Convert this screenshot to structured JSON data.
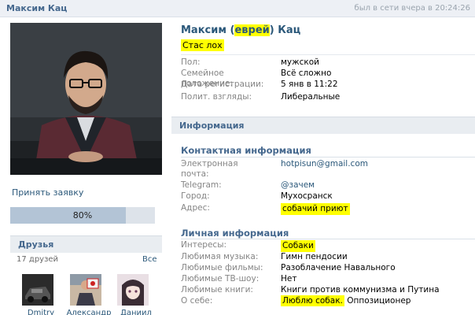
{
  "header": {
    "name": "Максим Кац",
    "online": "был в сети вчера в 20:24:26"
  },
  "left": {
    "accept_request": "Принять заявку",
    "progress_label": "80%",
    "progress_value": 0.8,
    "friends_title": "Друзья",
    "friends_count": "17 друзей",
    "friends_all": "Все",
    "friends": [
      {
        "name": "Dmitry",
        "icon": "friend-photo-dark-car"
      },
      {
        "name": "Александр",
        "icon": "friend-photo-man-with-sign"
      },
      {
        "name": "Даниил",
        "icon": "friend-photo-anime-girl"
      }
    ]
  },
  "profile": {
    "name_first": "Максим",
    "name_paren_open": "(",
    "name_nick": "еврей",
    "name_paren_close": ")",
    "name_last": "Кац",
    "status": "Стас лох",
    "basic": [
      {
        "label": "Пол:",
        "value": "мужской"
      },
      {
        "label": "Семейное положение:",
        "value": "Всё сложно"
      },
      {
        "label": "Дата регистрации:",
        "value": "5 янв в 11:22"
      },
      {
        "label": "Полит. взгляды:",
        "value": "Либеральные"
      }
    ]
  },
  "info": {
    "title": "Информация",
    "contact_title": "Контактная информация",
    "email_label_1": "Электронная",
    "email_label_2": "почта:",
    "email_value": "hotpisun@gmail.com",
    "telegram_label": "Telegram:",
    "telegram_value": "@зачем",
    "city_label": "Город:",
    "city_value": "Мухосранск",
    "address_label": "Адрес:",
    "address_value": "собачий приют",
    "personal_title": "Личная информация",
    "interests_label": "Интересы:",
    "interests_value": "Собаки",
    "music_label": "Любимая музыка:",
    "music_value": "Гимн пендосии",
    "films_label": "Любимые фильмы:",
    "films_value": "Разоблачение Навального",
    "tv_label": "Любимые ТВ-шоу:",
    "tv_value": "Нет",
    "books_label": "Любимые книги:",
    "books_value": "Книги против коммунизма и Путина",
    "about_label": "О себе:",
    "about_value_hl": "Люблю собак.",
    "about_value_rest": " Оппозиционер"
  },
  "colors": {
    "link": "#2b587a",
    "header_text": "#45688e",
    "bar_bg": "#e9edf1",
    "highlight": "#ffff00"
  }
}
